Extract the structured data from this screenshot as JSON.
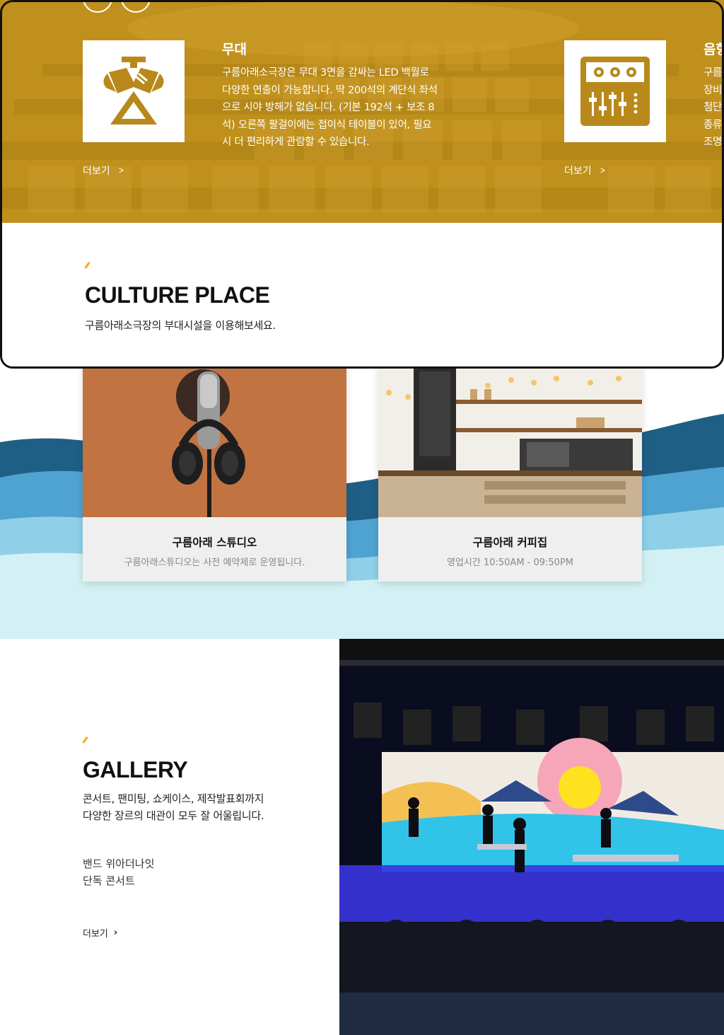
{
  "hero": {
    "carousel": {
      "prev_icon": "chevron-left-icon",
      "next_icon": "chevron-right-icon"
    },
    "features": [
      {
        "title": "무대",
        "icon": "stage-spotlight-icon",
        "lines": [
          "구름아래소극장은 무대 3면을 감싸는 LED 백월로",
          "다양한 연출이 가능합니다. 딱 200석의 계단식 좌석",
          "으로 시야 방해가 없습니다. (기본 192석 + 보조 8",
          "석) 오른쪽 팔걸이에는 접이식 테이블이 있어, 필요",
          "시 더 편리하게 관람할 수 있습니다."
        ],
        "more": "더보기"
      },
      {
        "title": "음향",
        "icon": "sound-mixer-icon",
        "lines": [
          "구름",
          "장비",
          "첨단",
          "종류",
          "조명"
        ],
        "more": "더보기"
      }
    ]
  },
  "culture": {
    "title": "CULTURE PLACE",
    "subtitle": "구름아래소극장의 부대시설을 이용해보세요.",
    "cards": [
      {
        "title": "구름아래 스튜디오",
        "desc": "구름아래스튜디오는 사전 예약제로 운영됩니다."
      },
      {
        "title": "구름아래 커피집",
        "desc": "영업시간 10:50AM - 09:50PM"
      }
    ]
  },
  "gallery": {
    "title": "GALLERY",
    "desc_lines": [
      "콘서트, 팬미팅, 쇼케이스, 제작발표회까지",
      "다양한 장르의 대관이 모두 잘 어울립니다."
    ],
    "caption_lines": [
      "밴드 위아더나잇",
      "단독 콘서트"
    ],
    "more": "더보기"
  },
  "colors": {
    "hero_gold": "#c89a22",
    "accent_orange": "#f1a91d",
    "wave_dark": "#1f5f86",
    "wave_mid": "#4fa3d1",
    "wave_light": "#8fd0e8",
    "wave_pale": "#d3f1f4"
  }
}
